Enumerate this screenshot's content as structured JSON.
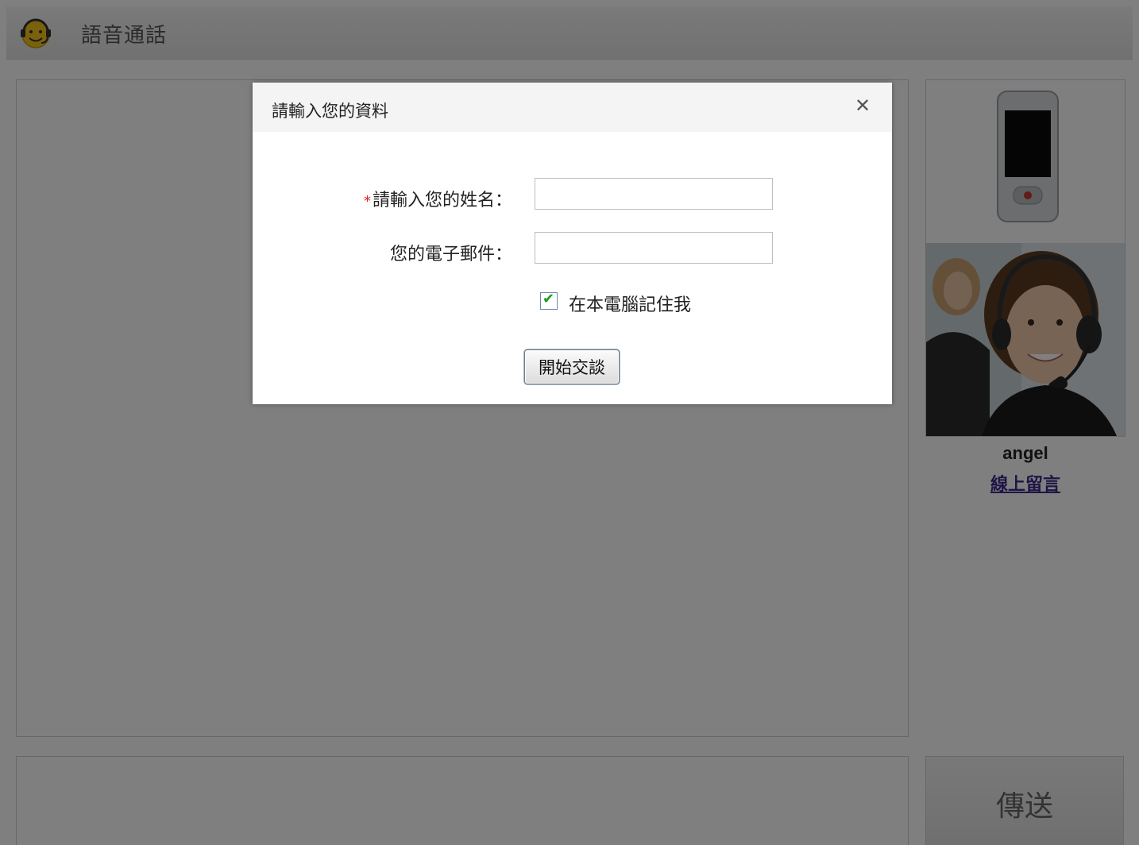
{
  "header": {
    "title": "語音通話",
    "logo_icon": "headset-smiley-icon"
  },
  "agent": {
    "name": "angel",
    "leave_message_link": "線上留言",
    "phone_icon": "mobile-phone-icon",
    "photo": "agent-photo"
  },
  "send_button": {
    "label": "傳送"
  },
  "dialog": {
    "title": "請輸入您的資料",
    "close_icon": "close-icon",
    "name_field": {
      "required_mark": "*",
      "label": "請輸入您的姓名：",
      "value": "",
      "placeholder": ""
    },
    "email_field": {
      "label": "您的電子郵件：",
      "value": "",
      "placeholder": ""
    },
    "remember": {
      "label": "在本電腦記住我",
      "checked": true
    },
    "start_button": {
      "label": "開始交談"
    }
  },
  "colors": {
    "overlay": "#000000",
    "required": "#e02020",
    "link": "#3f2a8c",
    "check": "#1f9a1f"
  }
}
